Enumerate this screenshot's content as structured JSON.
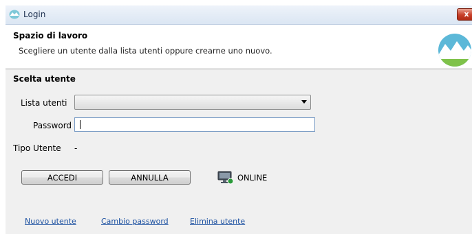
{
  "window": {
    "title": "Login",
    "close_glyph": "x"
  },
  "header": {
    "title": "Spazio di lavoro",
    "description": "Scegliere un utente dalla lista utenti oppure crearne uno nuovo.",
    "logo_icon": "mountain-logo-icon"
  },
  "section": {
    "title": "Scelta utente"
  },
  "form": {
    "user_list_label": "Lista utenti",
    "user_list_value": "",
    "password_label": "Password",
    "password_value": "",
    "user_type_label": "Tipo Utente",
    "user_type_value": "-"
  },
  "buttons": {
    "login": "ACCEDI",
    "cancel": "ANNULLA"
  },
  "status": {
    "text": "ONLINE",
    "icon": "computer-online-icon",
    "color": "#2a9a3a"
  },
  "links": {
    "new_user": "Nuovo utente",
    "change_password": "Cambio password",
    "delete_user": "Elimina utente"
  }
}
